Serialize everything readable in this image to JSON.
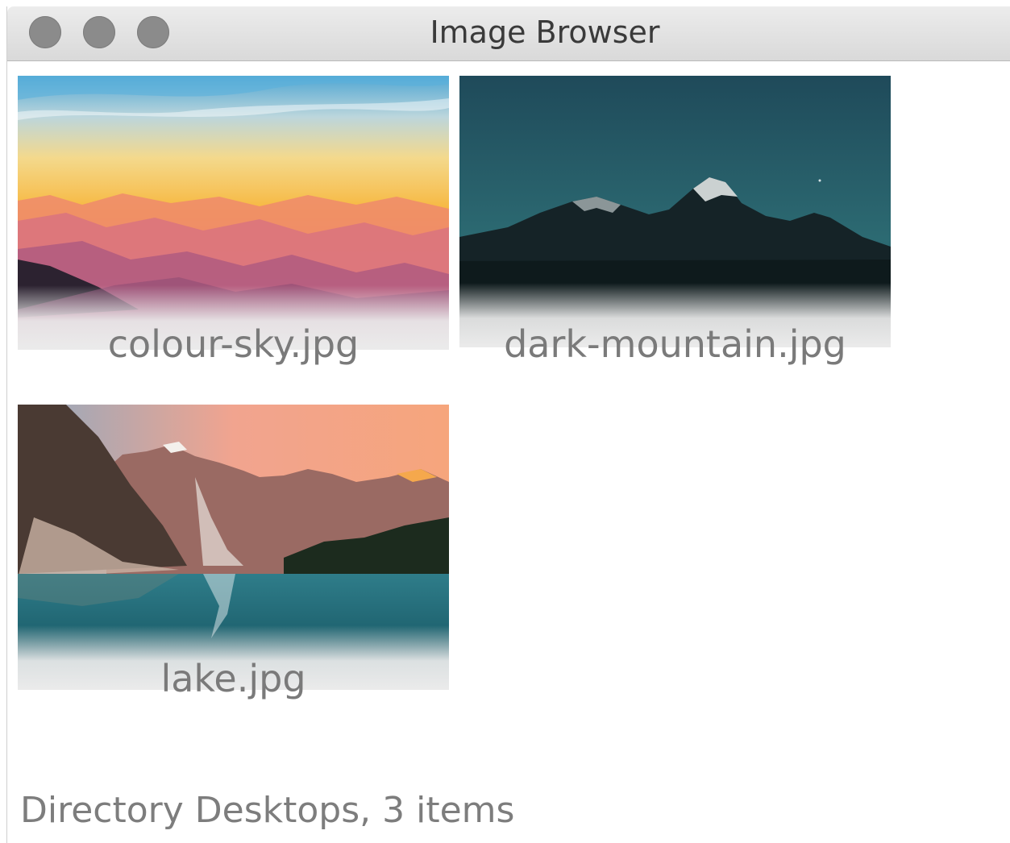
{
  "window": {
    "title": "Image Browser"
  },
  "thumbnails": [
    {
      "filename": "colour-sky.jpg"
    },
    {
      "filename": "dark-mountain.jpg"
    },
    {
      "filename": "lake.jpg"
    }
  ],
  "status": {
    "text": "Directory Desktops, 3 items"
  },
  "colors": {
    "label_text": "#7a7a7a",
    "traffic_light": "#8b8b8b",
    "titlebar": "#e3e3e3"
  }
}
